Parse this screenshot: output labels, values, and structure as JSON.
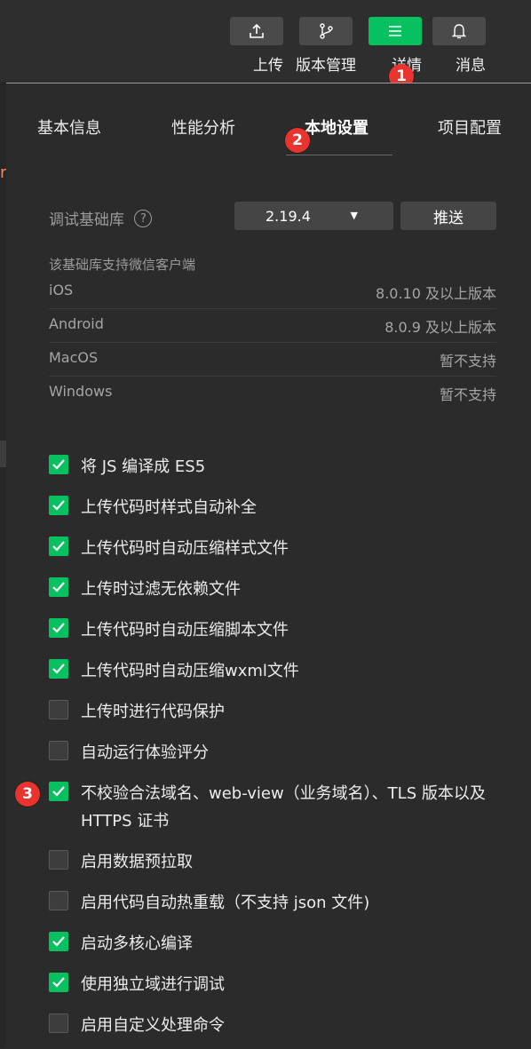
{
  "toolbar": {
    "upload_label": "上传",
    "version_label": "版本管理",
    "details_label": "详情",
    "messages_label": "消息",
    "accent": "#07c160"
  },
  "annotations": [
    "1",
    "2",
    "3"
  ],
  "tabs": [
    "基本信息",
    "性能分析",
    "本地设置",
    "项目配置"
  ],
  "active_tab": "本地设置",
  "debug_lib": {
    "label": "调试基础库",
    "help": "?",
    "version": "2.19.4",
    "push_label": "推送"
  },
  "support": {
    "title": "该基础库支持微信客户端",
    "rows": [
      {
        "name": "iOS",
        "value": "8.0.10 及以上版本"
      },
      {
        "name": "Android",
        "value": "8.0.9 及以上版本"
      },
      {
        "name": "MacOS",
        "value": "暂不支持"
      },
      {
        "name": "Windows",
        "value": "暂不支持"
      }
    ]
  },
  "options": [
    {
      "label": "将 JS 编译成 ES5",
      "checked": true
    },
    {
      "label": "上传代码时样式自动补全",
      "checked": true
    },
    {
      "label": "上传代码时自动压缩样式文件",
      "checked": true
    },
    {
      "label": "上传时过滤无依赖文件",
      "checked": true
    },
    {
      "label": "上传代码时自动压缩脚本文件",
      "checked": true
    },
    {
      "label": "上传代码时自动压缩wxml文件",
      "checked": true
    },
    {
      "label": "上传时进行代码保护",
      "checked": false
    },
    {
      "label": "自动运行体验评分",
      "checked": false
    },
    {
      "label": "不校验合法域名、web-view（业务域名）、TLS 版本以及 HTTPS 证书",
      "checked": true
    },
    {
      "label": "启用数据预拉取",
      "checked": false
    },
    {
      "label": "启用代码自动热重载（不支持 json 文件)",
      "checked": false
    },
    {
      "label": "启动多核心编译",
      "checked": true
    },
    {
      "label": "使用独立域进行调试",
      "checked": true
    },
    {
      "label": "启用自定义处理命令",
      "checked": false
    }
  ],
  "side_fragment": "r"
}
